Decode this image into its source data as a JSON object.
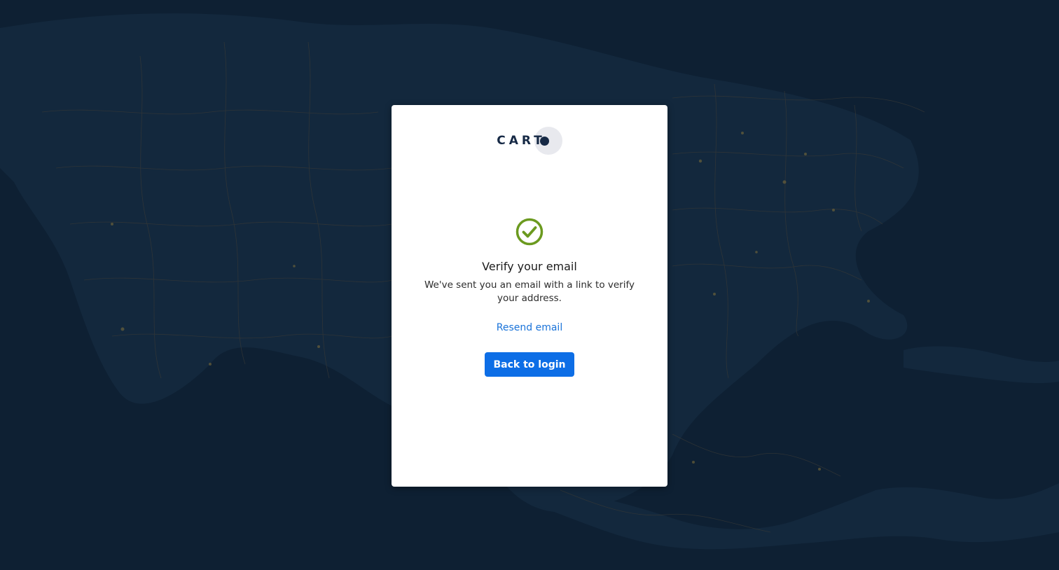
{
  "brand": {
    "logo_text": "CART",
    "color": "#162945"
  },
  "background": {
    "color": "#0e2033",
    "description_icon": "map-background"
  },
  "verify": {
    "icon": "check-circle-icon",
    "icon_color": "#6b9a1f",
    "title": "Verify your email",
    "message": "We've sent you an email with a link to verify your address.",
    "resend_label": "Resend email",
    "back_label": "Back to login"
  },
  "colors": {
    "link": "#1a73d9",
    "button": "#0d6ee6"
  }
}
